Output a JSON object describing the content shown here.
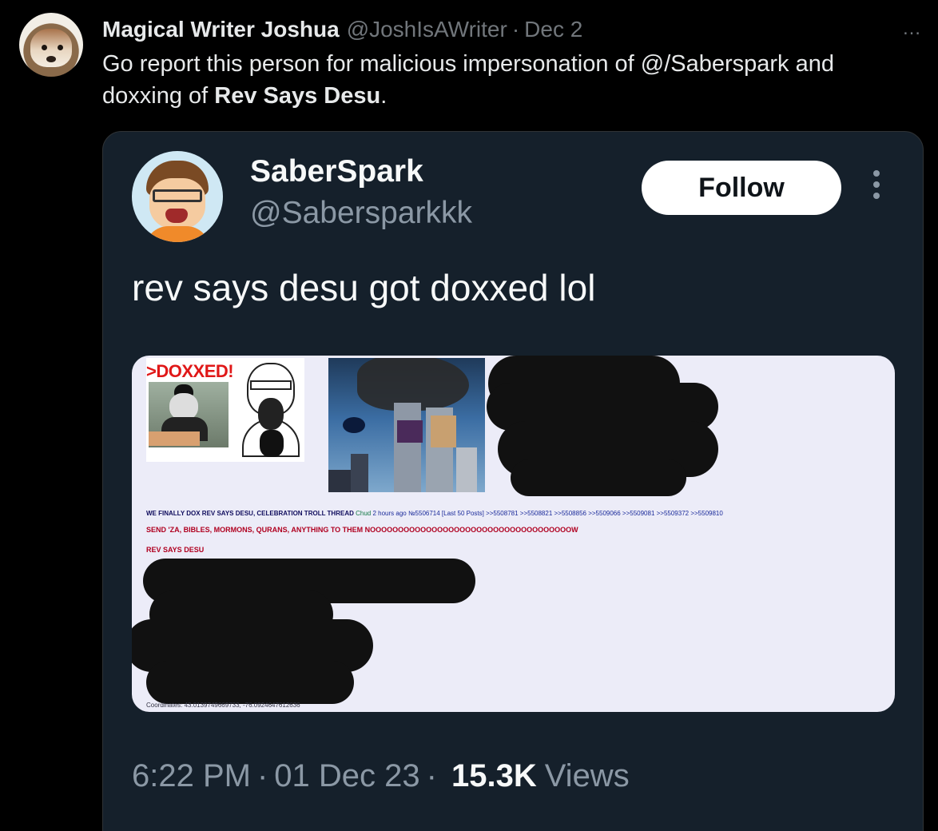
{
  "outer_post": {
    "author_name": "Magical Writer Joshua",
    "author_handle": "@JoshIsAWriter",
    "date": "Dec 2",
    "separator": "·",
    "more_icon": "…",
    "text_before": "Go report this person for malicious impersonation of @/Saberspark and doxxing of ",
    "text_bold": "Rev Says Desu",
    "text_after": "."
  },
  "quoted_post": {
    "author_name": "SaberSpark",
    "author_handle": "@Sabersparkkk",
    "follow_label": "Follow",
    "text": "rev says desu got doxxed lol",
    "time": "6:22 PM",
    "date": "01 Dec 23",
    "separator": "·",
    "views_count": "15.3K",
    "views_label": "Views"
  },
  "media": {
    "doxxed_label": ">DOXXED!",
    "thread_subject": "WE FINALLY DOX REV SAYS DESU, CELEBRATION TROLL THREAD",
    "thread_author": "Chud",
    "thread_meta": "2 hours ago №5506714",
    "thread_links": "[Last 50 Posts] >>5508781 >>5508821 >>5508856 >>5509066 >>5509081 >>5509372 >>5509810",
    "send_line": "SEND 'ZA, BIBLES, MORMONS, QURANS, ANYTHING TO THEM NOOOOOOOOOOOOOOOOOOOOOOOOOOOOOOOOOOOOW",
    "rev_line": "REV SAYS DESU",
    "coordinates": "Coordinates: 43.0139749669733, -76.0924647612636"
  },
  "colors": {
    "background": "#000000",
    "card_background": "#15202b",
    "muted_text": "#71767b",
    "follow_button": "#ffffff"
  }
}
